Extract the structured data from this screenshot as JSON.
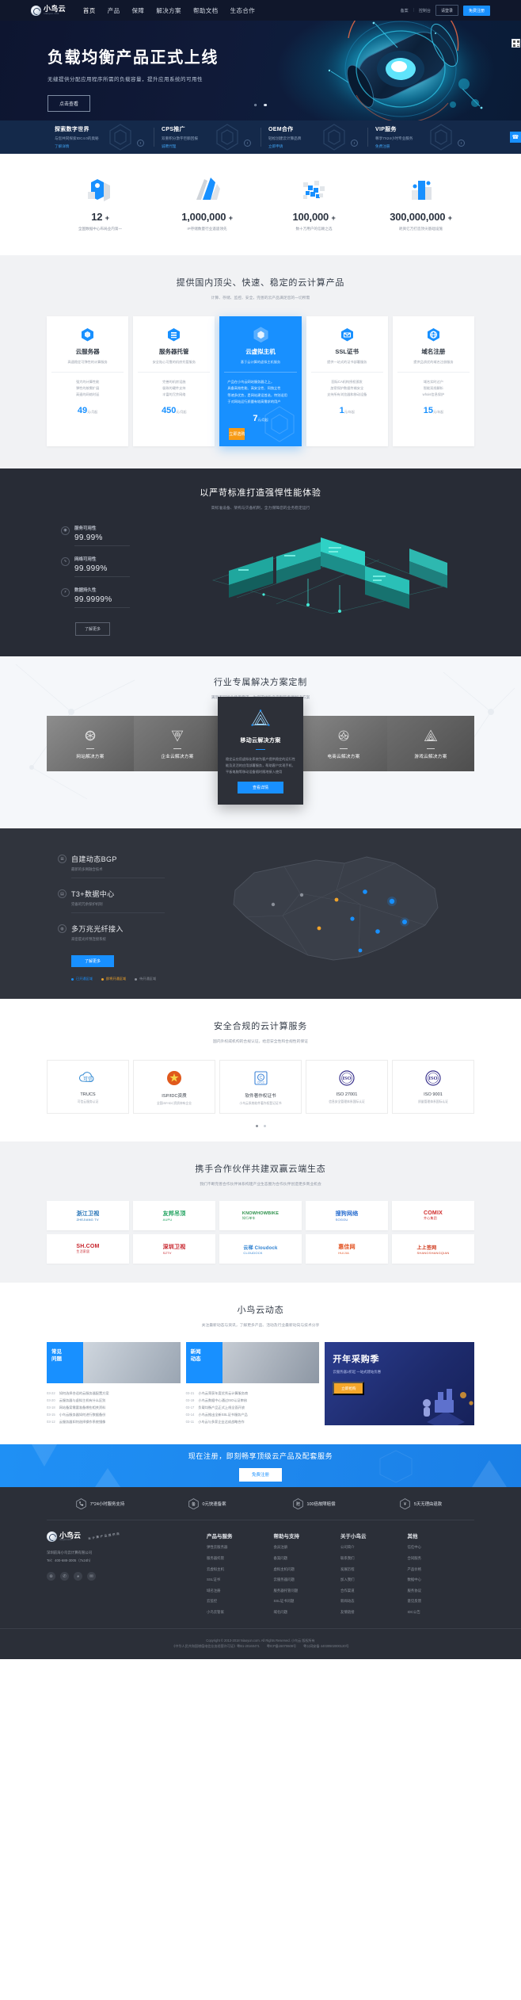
{
  "header": {
    "logo_cn": "小鸟云",
    "logo_en": "niaoyun.com",
    "nav": [
      {
        "label": "首页",
        "active": true
      },
      {
        "label": "产品",
        "active": false
      },
      {
        "label": "保障",
        "active": false
      },
      {
        "label": "解决方案",
        "active": false
      },
      {
        "label": "帮助文档",
        "active": false
      },
      {
        "label": "生态合作",
        "active": false
      }
    ],
    "links": [
      {
        "label": "备案"
      },
      {
        "label": "控制台"
      }
    ],
    "separator": "|",
    "login_label": "请登录",
    "register_label": "免费注册"
  },
  "hero": {
    "title": "负载均衡产品正式上线",
    "subtitle": "无缝提供分配应用程序所需的负载容量，提升应用系统的可用性",
    "button": "点击查看",
    "slides": 2,
    "active_slide": 2
  },
  "quick_cards": [
    {
      "title": "探索数字世界",
      "desc": "与您共同探索IDC4.0的奥秘",
      "link": "了解详情"
    },
    {
      "title": "CPS推广",
      "desc": "双重积分激字巨额回报",
      "link": "诚聘代理"
    },
    {
      "title": "OEM合作",
      "desc": "轻松创建云计算品牌",
      "link": "立即申请"
    },
    {
      "title": "VIP服务",
      "desc": "尊享7X24小时专业服务",
      "link": "免费注册"
    }
  ],
  "float_buttons": {
    "service": "customer-service",
    "qr": "qr-code"
  },
  "stats": [
    {
      "value": "12",
      "plus": "+",
      "label": "全国数据中心布局业内第一"
    },
    {
      "value": "1,000,000",
      "plus": "+",
      "label": "IP存储数量行业遥遥领先"
    },
    {
      "value": "100,000",
      "plus": "+",
      "label": "数十万用户的信赖之选"
    },
    {
      "value": "300,000,000",
      "plus": "+",
      "label": "耗资亿万打造顶尖基础设施"
    }
  ],
  "products": {
    "title": "提供国内顶尖、快速、稳定的云计算产品",
    "subtitle": "计算、存储、监控、安全，完善的云产品满足您的一切所需",
    "items": [
      {
        "name": "云服务器",
        "desc": "高速稳定可弹性的计算服务",
        "features": [
          "强大的计算性能",
          "弹性的按需扩展",
          "高速的网络时延"
        ],
        "price": "49",
        "unit": "元/月起",
        "highlight": false
      },
      {
        "name": "服务器托管",
        "desc": "安全贴心可靠的机房托管服务",
        "features": [
          "完善的机房设施",
          "极致的硬件支持",
          "丰富的冗余网络"
        ],
        "price": "450",
        "unit": "元/月起",
        "highlight": false
      },
      {
        "name": "云虚拟主机",
        "desc": "基于云计算的虚拟主机服务",
        "features": [
          "产品在小鸟云网站服务器之上，",
          "具备高效性能、高安全性、同独立性",
          "等诸多优势，是网站建设首选，特别适用",
          "于对网站运行质量有较高需求的用户"
        ],
        "price": "7",
        "unit": "元/月起",
        "buy_label": "立即选购",
        "highlight": true
      },
      {
        "name": "SSL证书",
        "desc": "提供一站式的证书部署服务",
        "features": [
          "国际CA机构授权颁发",
          "加密保护数据传输安全",
          "支持所有浏览器和移动设备"
        ],
        "price": "1",
        "unit": "元/年起",
        "highlight": false
      },
      {
        "name": "域名注册",
        "desc": "提供品质优的域名注册服务",
        "features": [
          "域名实时过户",
          "智能双线解析",
          "whois信息保护"
        ],
        "price": "15",
        "unit": "元/年起",
        "highlight": false
      }
    ]
  },
  "reliability": {
    "title": "以严苛标准打造强悍性能体验",
    "subtitle": "高标准设备、架构与灾备机制，全力保障您的业务稳定运行",
    "metrics": [
      {
        "label": "服务可用性",
        "value": "99.99%",
        "icon": "signal-icon"
      },
      {
        "label": "网络可用性",
        "value": "99.999%",
        "icon": "pulse-icon"
      },
      {
        "label": "数据持久性",
        "value": "99.9999%",
        "icon": "bolt-icon"
      }
    ],
    "button": "了解更多"
  },
  "solutions": {
    "title": "行业专属解决方案定制",
    "subtitle": "满足不同行业场景需求，为您提供贴身定制的专属解决方案",
    "items": [
      {
        "name": "网站解决方案",
        "icon": "web-icon",
        "active": false
      },
      {
        "name": "企业云解决方案",
        "icon": "enterprise-icon",
        "active": false
      },
      {
        "name": "移动云解决方案",
        "icon": "mobile-icon",
        "active": true,
        "desc": "稳定云应用虚拟化系统为客户提供稳定的运行性能及灵活的应用部署服务，帮助客户实现手机、平板电脑等移动设备随时随地接入使用",
        "button": "查看详情"
      },
      {
        "name": "电商云解决方案",
        "icon": "ecommerce-icon",
        "active": false
      },
      {
        "name": "游戏云解决方案",
        "icon": "game-icon",
        "active": false
      }
    ]
  },
  "network": {
    "items": [
      {
        "title": "自建动态BGP",
        "desc": "最新的多网融合技术",
        "icon": "network-icon"
      },
      {
        "title": "T3+数据中心",
        "desc": "完备的冗余保护机制",
        "icon": "datacenter-icon"
      },
      {
        "title": "多万兆光纤接入",
        "desc": "高密度光纤预连接系统",
        "icon": "fiber-icon"
      }
    ],
    "button": "了解更多",
    "legend": [
      {
        "label": "已开通区域",
        "color": "#1890ff"
      },
      {
        "label": "即将开通区域",
        "color": "#f0a32a"
      },
      {
        "label": "待开通区域",
        "color": "#8a8f99"
      }
    ]
  },
  "certs": {
    "title": "安全合规的云计算服务",
    "subtitle": "国内外权威机构的合规认证，给您安全性和合规性的保证",
    "items": [
      {
        "name": "TRUCS",
        "desc": "可信云服务认证",
        "badge": "trucs-badge"
      },
      {
        "name": "ISP/IDC资质",
        "desc": "全国ISP/IDC资质持有企业",
        "badge": "gov-badge"
      },
      {
        "name": "软件著作权证书",
        "desc": "小鸟云系统软件著作权登记证书",
        "badge": "copyright-badge"
      },
      {
        "name": "ISO 27001",
        "desc": "信息安全管理体系国际认证",
        "badge": "iso27001-badge"
      },
      {
        "name": "ISO 9001",
        "desc": "质量管理体系国际认证",
        "badge": "iso9001-badge"
      }
    ],
    "dots": 2,
    "active_dot": 1
  },
  "partners": {
    "title": "携手合作伙伴共建双赢云端生态",
    "subtitle": "我们不断完善合作伙伴体系构建产业生态圈为合作伙伴创造更多商业机会",
    "row1": [
      {
        "name": "浙江卫视",
        "sub": "ZHEJIANG TV"
      },
      {
        "name": "友邦吊顶",
        "sub": "AUPU"
      },
      {
        "name": "KNOWHOWBIKE",
        "sub": "知行单车"
      },
      {
        "name": "搜狗网络",
        "sub": "SOGOU"
      },
      {
        "name": "COMIX",
        "sub": "齐心集团"
      }
    ],
    "row2": [
      {
        "name": "SH.COM",
        "sub": "生活家居"
      },
      {
        "name": "深圳卫视",
        "sub": "SZTV"
      },
      {
        "name": "云梯 Cloudock",
        "sub": "CLOUDOCK"
      },
      {
        "name": "惠佳网",
        "sub": "HUIJIA"
      },
      {
        "name": "上上签网",
        "sub": "SHANGSHANGQIAN"
      }
    ]
  },
  "news": {
    "title": "小鸟云动态",
    "subtitle": "关注最新动态与资讯，了解更多产品、活动及行业最新动向与技术分享",
    "col1": {
      "tag_line1": "常见",
      "tag_line2": "问题",
      "items": [
        {
          "date": "03-22",
          "text": "如何选择合适的云服务器配置方案"
        },
        {
          "date": "03-20",
          "text": "云服务器与虚拟主机有什么区别"
        },
        {
          "date": "03-18",
          "text": "网站备案需要准备哪些相关资料"
        },
        {
          "date": "03-15",
          "text": "小鸟云服务器如何进行数据备份"
        },
        {
          "date": "03-12",
          "text": "云服务器如何选择操作系统镜像"
        }
      ]
    },
    "col2": {
      "tag_line1": "新闻",
      "tag_line2": "动态",
      "items": [
        {
          "date": "03-21",
          "text": "小鸟云荣获年度优秀云计算服务商"
        },
        {
          "date": "03-19",
          "text": "小鸟云数据中心通过ISO认证审核"
        },
        {
          "date": "03-17",
          "text": "负载均衡产品正式上线全面开放"
        },
        {
          "date": "03-14",
          "text": "小鸟云推出全新SSL证书服务产品"
        },
        {
          "date": "03-11",
          "text": "小鸟云与多家企业达成战略合作"
        }
      ]
    },
    "promo": {
      "title": "开年采购季",
      "subtitle": "云服务器1折起 一站式建站优惠",
      "button": "立即抢购"
    }
  },
  "cta": {
    "title": "现在注册，即刻畅享顶级云产品及配套服务",
    "button": "免费注册"
  },
  "footer": {
    "features": [
      {
        "label": "7*24小时服务支持",
        "icon": "phone-icon"
      },
      {
        "label": "0元快速备案",
        "icon": "record-icon"
      },
      {
        "label": "100倍故障赔偿",
        "icon": "compensate-icon"
      },
      {
        "label": "5天无理由退款",
        "icon": "refund-icon"
      }
    ],
    "logo_cn": "小鸟云",
    "logo_en": "niaoyun.com",
    "badge": "云 计 算 产 品 提 供 商",
    "company": "深圳前海小鸟云计算有限公司",
    "tel": "Tel：400-688-3005（7x24h）",
    "social": [
      "weibo-icon",
      "wechat-icon",
      "qq-icon",
      "mail-icon"
    ],
    "columns": [
      {
        "heading": "产品与服务",
        "links": [
          "弹性云服务器",
          "服务器托管",
          "云虚拟主机",
          "SSL证书",
          "域名注册",
          "云监控",
          "小鸟云管家"
        ]
      },
      {
        "heading": "帮助与支持",
        "links": [
          "会员注册",
          "备案问题",
          "虚拟主机问题",
          "云服务器问题",
          "服务器托管问题",
          "SSL证书问题",
          "域名问题"
        ]
      },
      {
        "heading": "关于小鸟云",
        "links": [
          "公司简介",
          "联系我们",
          "发展历程",
          "加入我们",
          "合作渠道",
          "新闻动态",
          "友情链接"
        ]
      },
      {
        "heading": "其他",
        "links": [
          "信任中心",
          "合同服务",
          "产品价格",
          "数据中心",
          "服务协议",
          "意见反馈",
          "IDC公告"
        ]
      }
    ],
    "copyright": "Copyright © 2013-2018 Niaoyun.com. All Rights Reserved. 小鸟云 版权所有",
    "license": "《中华人民共和国增值电信业务经营许可证》粤B1-20160471",
    "icp": "粤ICP备15070609号",
    "police": "粤公网安备 44030502000120号"
  }
}
